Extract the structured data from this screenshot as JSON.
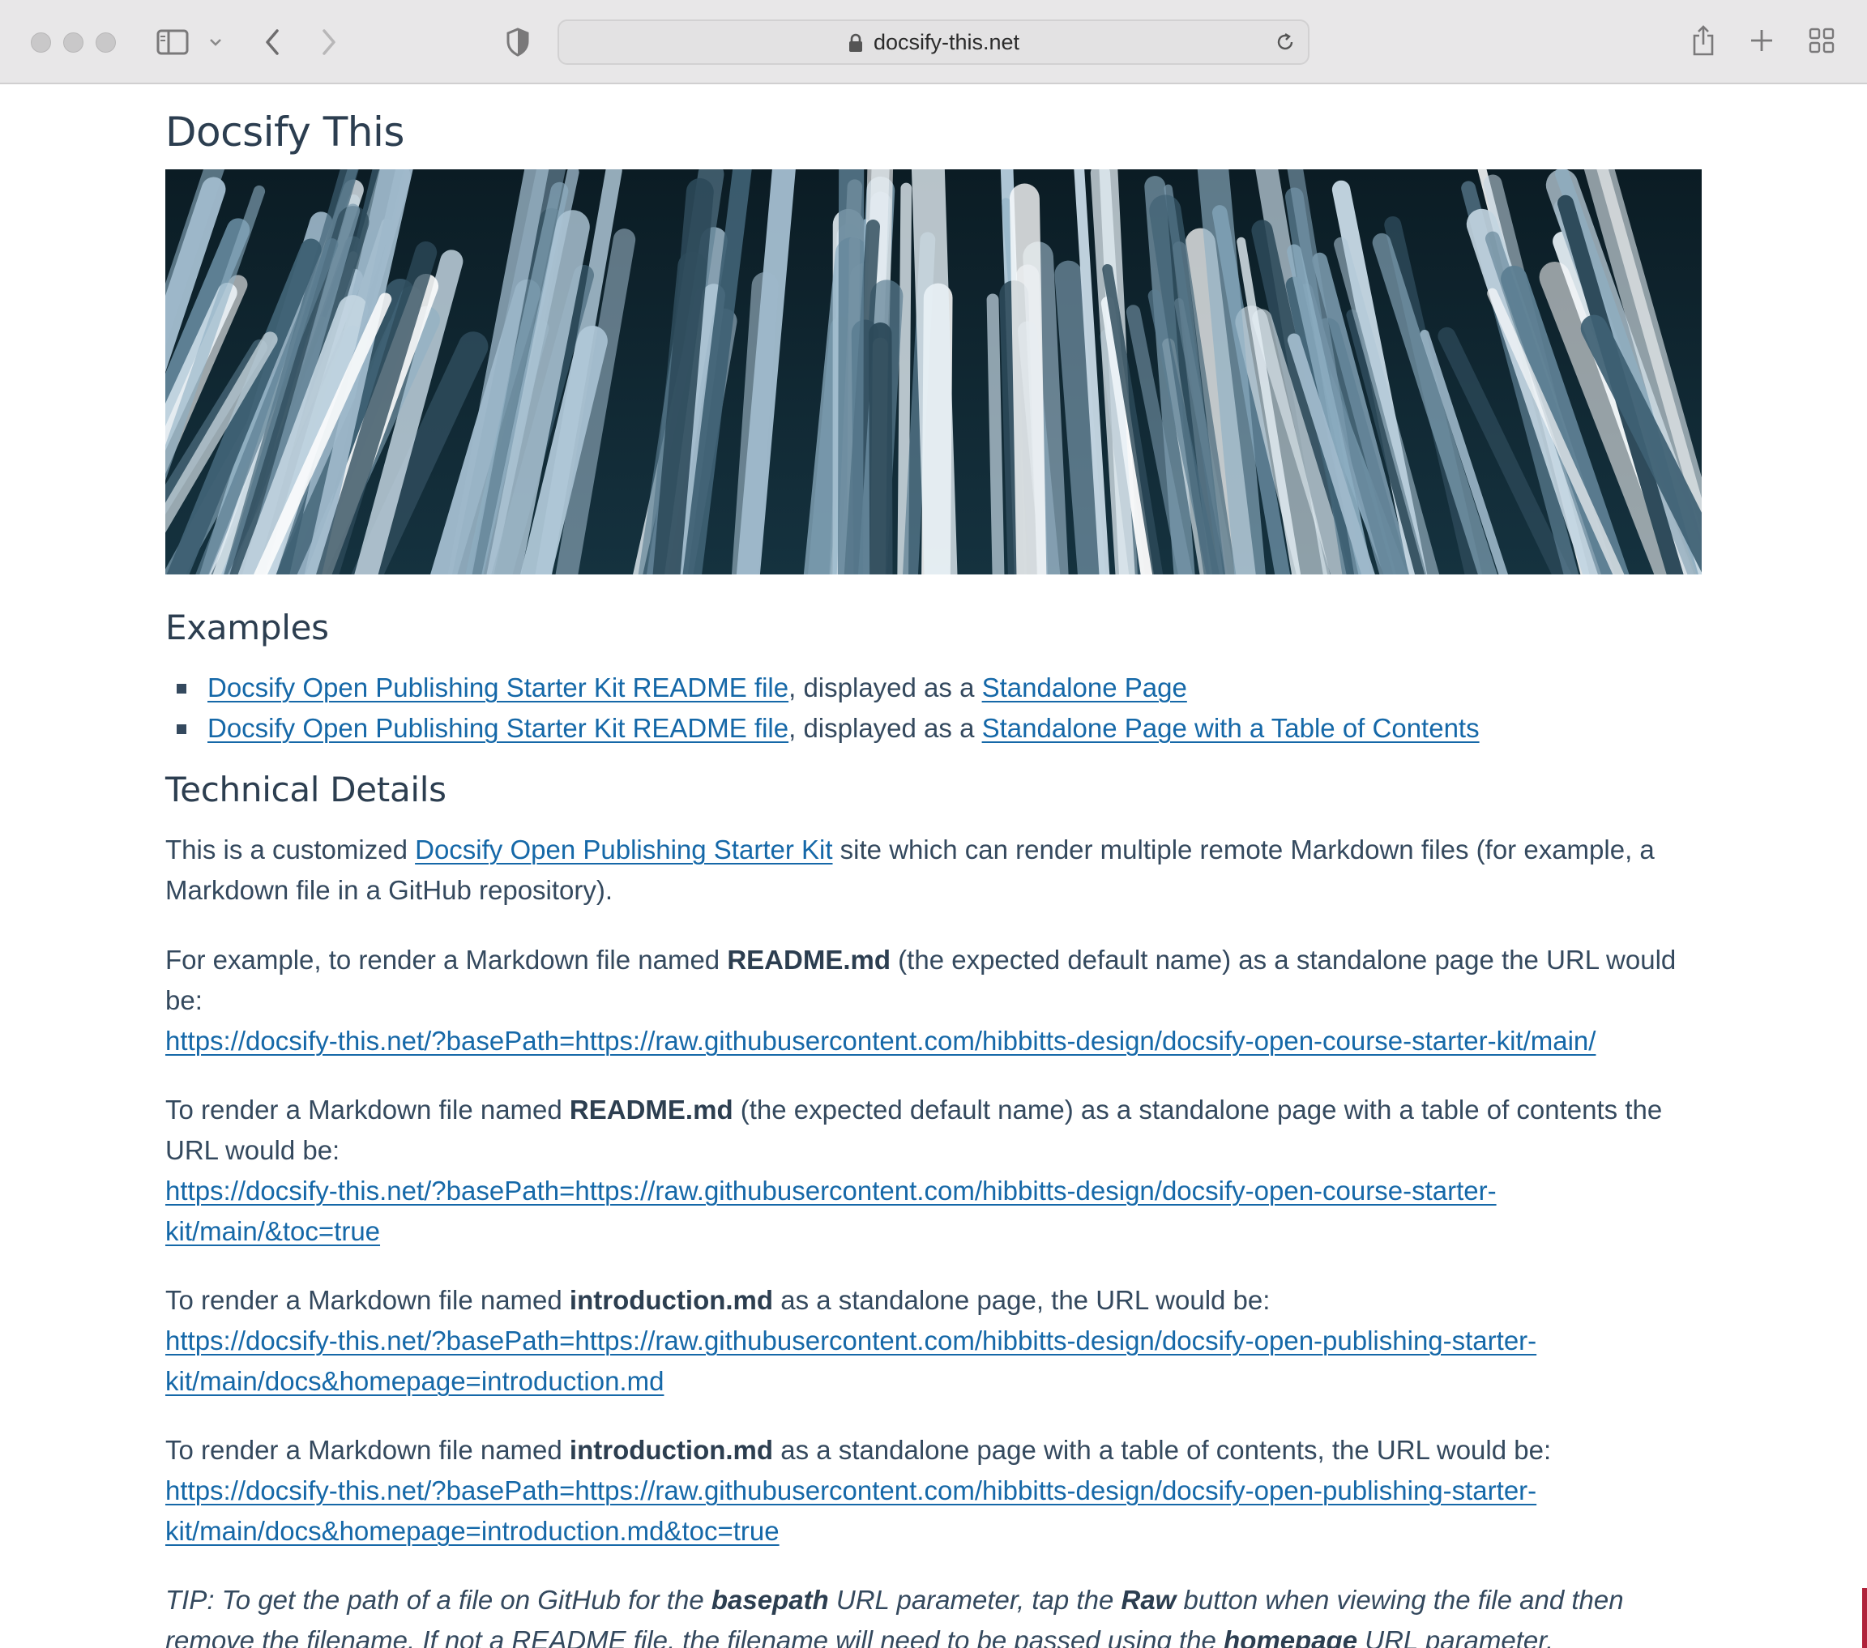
{
  "browser": {
    "url": "docsify-this.net"
  },
  "page": {
    "title": "Docsify This",
    "examples_heading": "Examples",
    "examples": [
      {
        "link1": "Docsify Open Publishing Starter Kit README file",
        "middle": ", displayed as a ",
        "link2": "Standalone Page"
      },
      {
        "link1": "Docsify Open Publishing Starter Kit README file",
        "middle": ", displayed as a ",
        "link2": "Standalone Page with a Table of Contents"
      }
    ],
    "tech_heading": "Technical Details",
    "intro": {
      "before": "This is a customized ",
      "link": "Docsify Open Publishing Starter Kit",
      "after_line1": " site which can render multiple remote Markdown files (for example, a",
      "line2": "Markdown file in a GitHub repository)."
    },
    "p1": {
      "before": "For example, to render a Markdown file named ",
      "bold": "README.md",
      "after_line1": " (the expected default name) as a standalone page the URL would",
      "line2": "be:",
      "url": "https://docsify-this.net/?basePath=https://raw.githubusercontent.com/hibbitts-design/docsify-open-course-starter-kit/main/"
    },
    "p2": {
      "before": "To render a Markdown file named ",
      "bold": "README.md",
      "after_line1": " (the expected default name) as a standalone page with a table of contents the",
      "line2": "URL would be:",
      "url_line1": "https://docsify-this.net/?basePath=https://raw.githubusercontent.com/hibbitts-design/docsify-open-course-starter-",
      "url_line2": "kit/main/&toc=true"
    },
    "p3": {
      "before": "To render a Markdown file named ",
      "bold": "introduction.md",
      "after": " as a standalone page, the URL would be:",
      "url_line1": "https://docsify-this.net/?basePath=https://raw.githubusercontent.com/hibbitts-design/docsify-open-publishing-starter-",
      "url_line2": "kit/main/docs&homepage=introduction.md"
    },
    "p4": {
      "before": "To render a Markdown file named ",
      "bold": "introduction.md",
      "after": " as a standalone page with a table of contents, the URL would be:",
      "url_line1": "https://docsify-this.net/?basePath=https://raw.githubusercontent.com/hibbitts-design/docsify-open-publishing-starter-",
      "url_line2": "kit/main/docs&homepage=introduction.md&toc=true"
    },
    "tip": {
      "t1": "TIP: To get the path of a file on GitHub for the ",
      "b1": "basepath",
      "t2": " URL parameter, tap the ",
      "b2": "Raw",
      "t3": " button when viewing the file and then",
      "t4": "remove the filename. If not a README file, the filename will need to be passed using the ",
      "b3": "homepage",
      "t5": " URL parameter."
    }
  },
  "colors": {
    "link": "#1568a8",
    "text": "#34495e",
    "toolbar": "#e8e7e8"
  },
  "icons": [
    "sidebar-icon",
    "chevron-down-icon",
    "back-icon",
    "forward-icon",
    "shield-icon",
    "lock-icon",
    "reload-icon",
    "share-icon",
    "new-tab-icon",
    "tab-overview-icon"
  ]
}
